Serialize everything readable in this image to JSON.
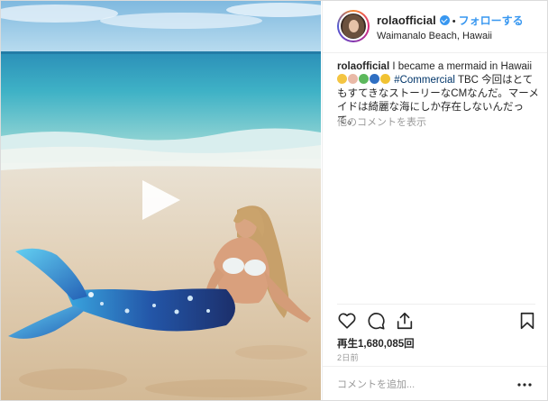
{
  "post": {
    "username": "rolaofficial",
    "follow_label": "フォローする",
    "separator": "•",
    "location": "Waimanalo Beach, Hawaii"
  },
  "caption": {
    "username": "rolaofficial",
    "text_part1": " I became a mermaid in Hawaii",
    "hashtag": "#Commercial",
    "text_part2": " TBC 今回はとてもすてきなストーリーなCMなんだ。マーメイドは綺麗な海にしか存在しないんだって。",
    "emojis": [
      "smile-emoji",
      "shell-emoji",
      "island-emoji",
      "globe-emoji",
      "crown-emoji"
    ]
  },
  "comments": {
    "view_more_label": "他のコメントを表示"
  },
  "stats": {
    "views": "再生1,680,085回",
    "time_ago": "2日前"
  },
  "comment_box": {
    "placeholder": "コメントを追加...",
    "more_label": "..."
  },
  "colors": {
    "accent": "#3897f0",
    "hashtag": "#003569",
    "muted": "#999999"
  },
  "icons": [
    "play-icon",
    "heart-icon",
    "comment-icon",
    "share-icon",
    "bookmark-icon",
    "verified-icon"
  ]
}
